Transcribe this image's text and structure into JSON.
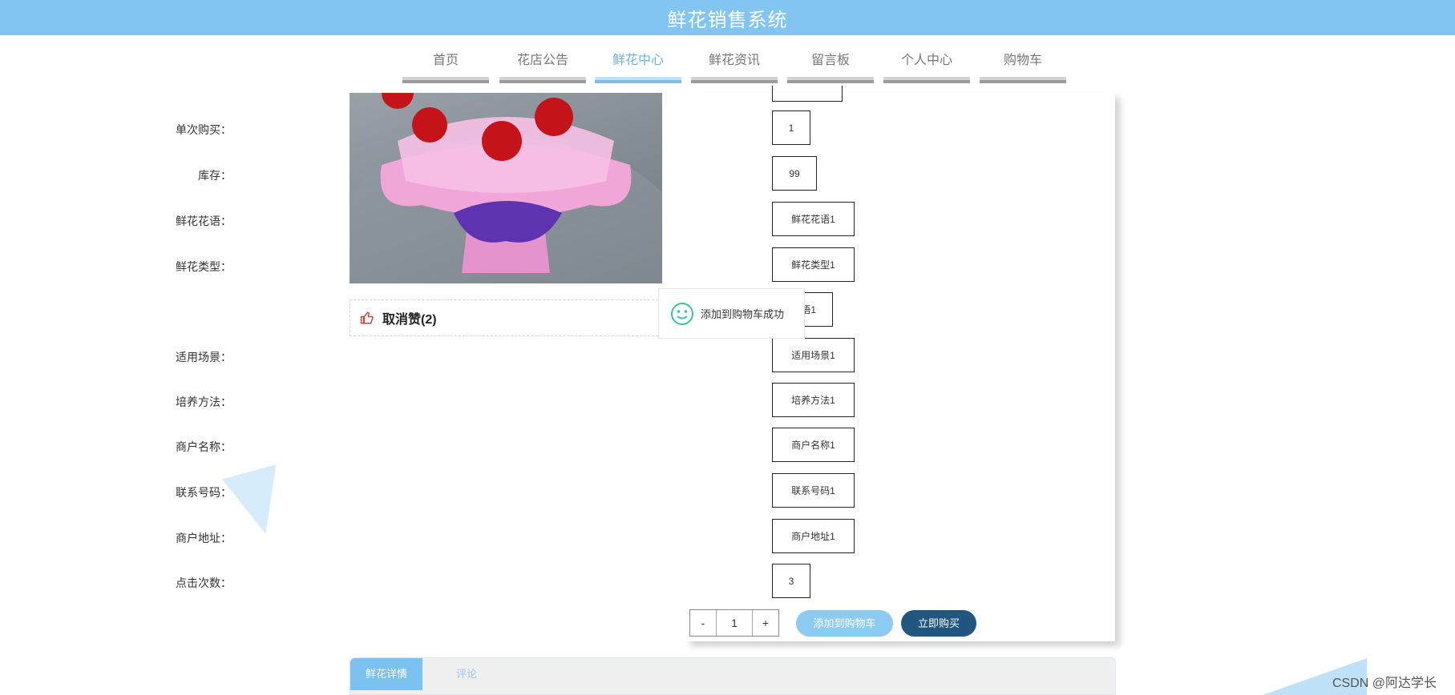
{
  "app": {
    "title": "鲜花销售系统"
  },
  "nav": [
    {
      "label": "首页"
    },
    {
      "label": "花店公告"
    },
    {
      "label": "鲜花中心",
      "active": true
    },
    {
      "label": "鲜花资讯"
    },
    {
      "label": "留言板"
    },
    {
      "label": "个人中心"
    },
    {
      "label": "购物车"
    }
  ],
  "product": {
    "like_label": "取消赞(2)",
    "fields": [
      {
        "label": "单次购买：",
        "value": "1"
      },
      {
        "label": "库存：",
        "value": "99"
      },
      {
        "label": "鲜花花语：",
        "value": "鲜花花语1"
      },
      {
        "label": "鲜花类型：",
        "value": "鲜花类型1"
      },
      {
        "label": "",
        "value": "语1"
      },
      {
        "label": "适用场景：",
        "value": "适用场景1"
      },
      {
        "label": "培养方法：",
        "value": "培养方法1"
      },
      {
        "label": "商户名称：",
        "value": "商户名称1"
      },
      {
        "label": "联系号码：",
        "value": "联系号码1"
      },
      {
        "label": "商户地址：",
        "value": "商户地址1"
      },
      {
        "label": "点击次数：",
        "value": "3"
      }
    ],
    "quantity": "1",
    "minus_label": "-",
    "plus_label": "+",
    "add_cart_label": "添加到购物车",
    "buy_now_label": "立即购买"
  },
  "toast": {
    "message": "添加到购物车成功"
  },
  "tabs": [
    {
      "label": "鲜花详情"
    },
    {
      "label": "评论"
    }
  ],
  "watermark": "CSDN @阿达学长",
  "colors": {
    "header": "#83c5f2",
    "accent": "#6ab4ea",
    "buy_button": "#20567f",
    "cart_button": "#8ccbf1"
  }
}
